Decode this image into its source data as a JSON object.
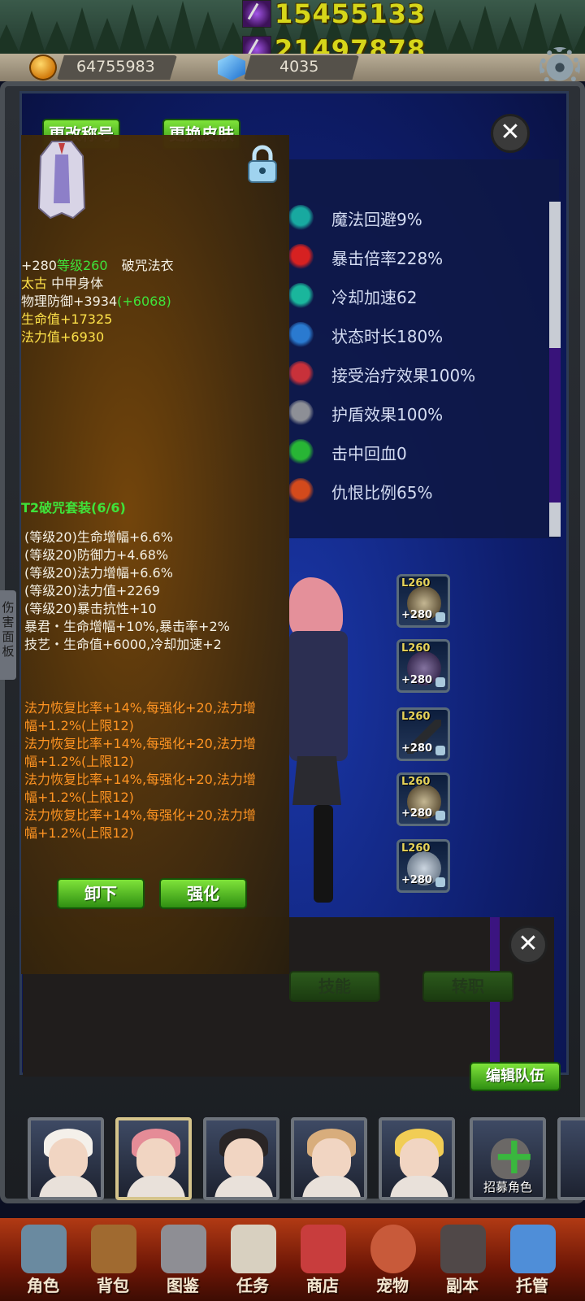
{
  "top_stats": {
    "power": "15455133",
    "power_2": "21497878"
  },
  "currency": {
    "gold": "64755983",
    "gems": "4035"
  },
  "main_panel": {
    "btn_change_title": "更改称号",
    "btn_change_skin": "更换皮肤",
    "side_tab": "伤害面板",
    "close_symbol": "✕"
  },
  "stats": [
    {
      "label": "魔法回避9%",
      "icon": "magic-dodge-icon",
      "color": "#18a9a0"
    },
    {
      "label": "暴击倍率228%",
      "icon": "crit-multiplier-icon",
      "color": "#d62121"
    },
    {
      "label": "冷却加速62",
      "icon": "cooldown-hourglass-icon",
      "color": "#1ab69c"
    },
    {
      "label": "状态时长180%",
      "icon": "status-duration-icon",
      "color": "#2a7ad0"
    },
    {
      "label": "接受治疗效果100%",
      "icon": "healing-received-icon",
      "color": "#c8313a"
    },
    {
      "label": "护盾效果100%",
      "icon": "shield-effect-icon",
      "color": "#8d8f96"
    },
    {
      "label": "击中回血0",
      "icon": "lifesteal-icon",
      "color": "#28b535"
    },
    {
      "label": "仇恨比例65%",
      "icon": "aggro-demon-icon",
      "color": "#d34a1c"
    }
  ],
  "equipment": [
    {
      "level": "L260",
      "plus": "+280",
      "icon": "necklace-icon"
    },
    {
      "level": "L260",
      "plus": "+280",
      "icon": "armor-icon"
    },
    {
      "level": "L260",
      "plus": "+280",
      "icon": "staff-icon"
    },
    {
      "level": "L260",
      "plus": "+280",
      "icon": "beads-icon"
    },
    {
      "level": "L260",
      "plus": "+280",
      "icon": "boots-icon"
    }
  ],
  "lower_panel": {
    "btn_skill": "技能",
    "btn_job": "转职",
    "btn_edit_team": "编辑队伍",
    "close_symbol": "✕"
  },
  "roster": {
    "heroes": [
      {
        "name": "hero-white-hood",
        "hair": "#f4f0ea"
      },
      {
        "name": "hero-pink-hair",
        "hair": "#e58c97"
      },
      {
        "name": "hero-catgirl",
        "hair": "#2a2525"
      },
      {
        "name": "hero-bun-hair",
        "hair": "#d8ad7c"
      },
      {
        "name": "hero-blonde",
        "hair": "#f1cd55"
      }
    ],
    "recruit_label": "招募角色"
  },
  "bottom_nav": [
    {
      "label": "角色",
      "icon": "helmet-icon",
      "color": "#6a8aa0"
    },
    {
      "label": "背包",
      "icon": "backpack-icon",
      "color": "#a06a30"
    },
    {
      "label": "图鉴",
      "icon": "book-icon",
      "color": "#8e8e94"
    },
    {
      "label": "任务",
      "icon": "scroll-icon",
      "color": "#d8d0c0"
    },
    {
      "label": "商店",
      "icon": "shop-icon",
      "color": "#c83d3d"
    },
    {
      "label": "宠物",
      "icon": "meat-icon",
      "color": "#c85a3a"
    },
    {
      "label": "副本",
      "icon": "skull-icon",
      "color": "#504848"
    },
    {
      "label": "托管",
      "icon": "calendar-icon",
      "color": "#4f8ed8"
    }
  ],
  "tooltip": {
    "plus": "+280",
    "level": "等级260",
    "item_name": "破咒法衣",
    "tier": "太古",
    "item_type": "中甲身体",
    "defense": "物理防御+3934",
    "defense_bonus": "(+6068)",
    "hp": "生命值+17325",
    "mp": "法力值+6930",
    "set_title": "T2破咒套装(6/6)",
    "set_bonuses": [
      "(等级20)生命增幅+6.6%",
      "(等级20)防御力+4.68%",
      "(等级20)法力增幅+6.6%",
      "(等级20)法力值+2269",
      "(等级20)暴击抗性+10",
      "暴君・生命增幅+10%,暴击率+2%",
      "技艺・生命值+6000,冷却加速+2"
    ],
    "affixes": [
      "法力恢复比率+14%,每强化+20,法力增",
      "幅+1.2%(上限12)",
      "法力恢复比率+14%,每强化+20,法力增",
      "幅+1.2%(上限12)",
      "法力恢复比率+14%,每强化+20,法力增",
      "幅+1.2%(上限12)",
      "法力恢复比率+14%,每强化+20,法力增",
      "幅+1.2%(上限12)"
    ],
    "btn_unequip": "卸下",
    "btn_enhance": "强化"
  }
}
